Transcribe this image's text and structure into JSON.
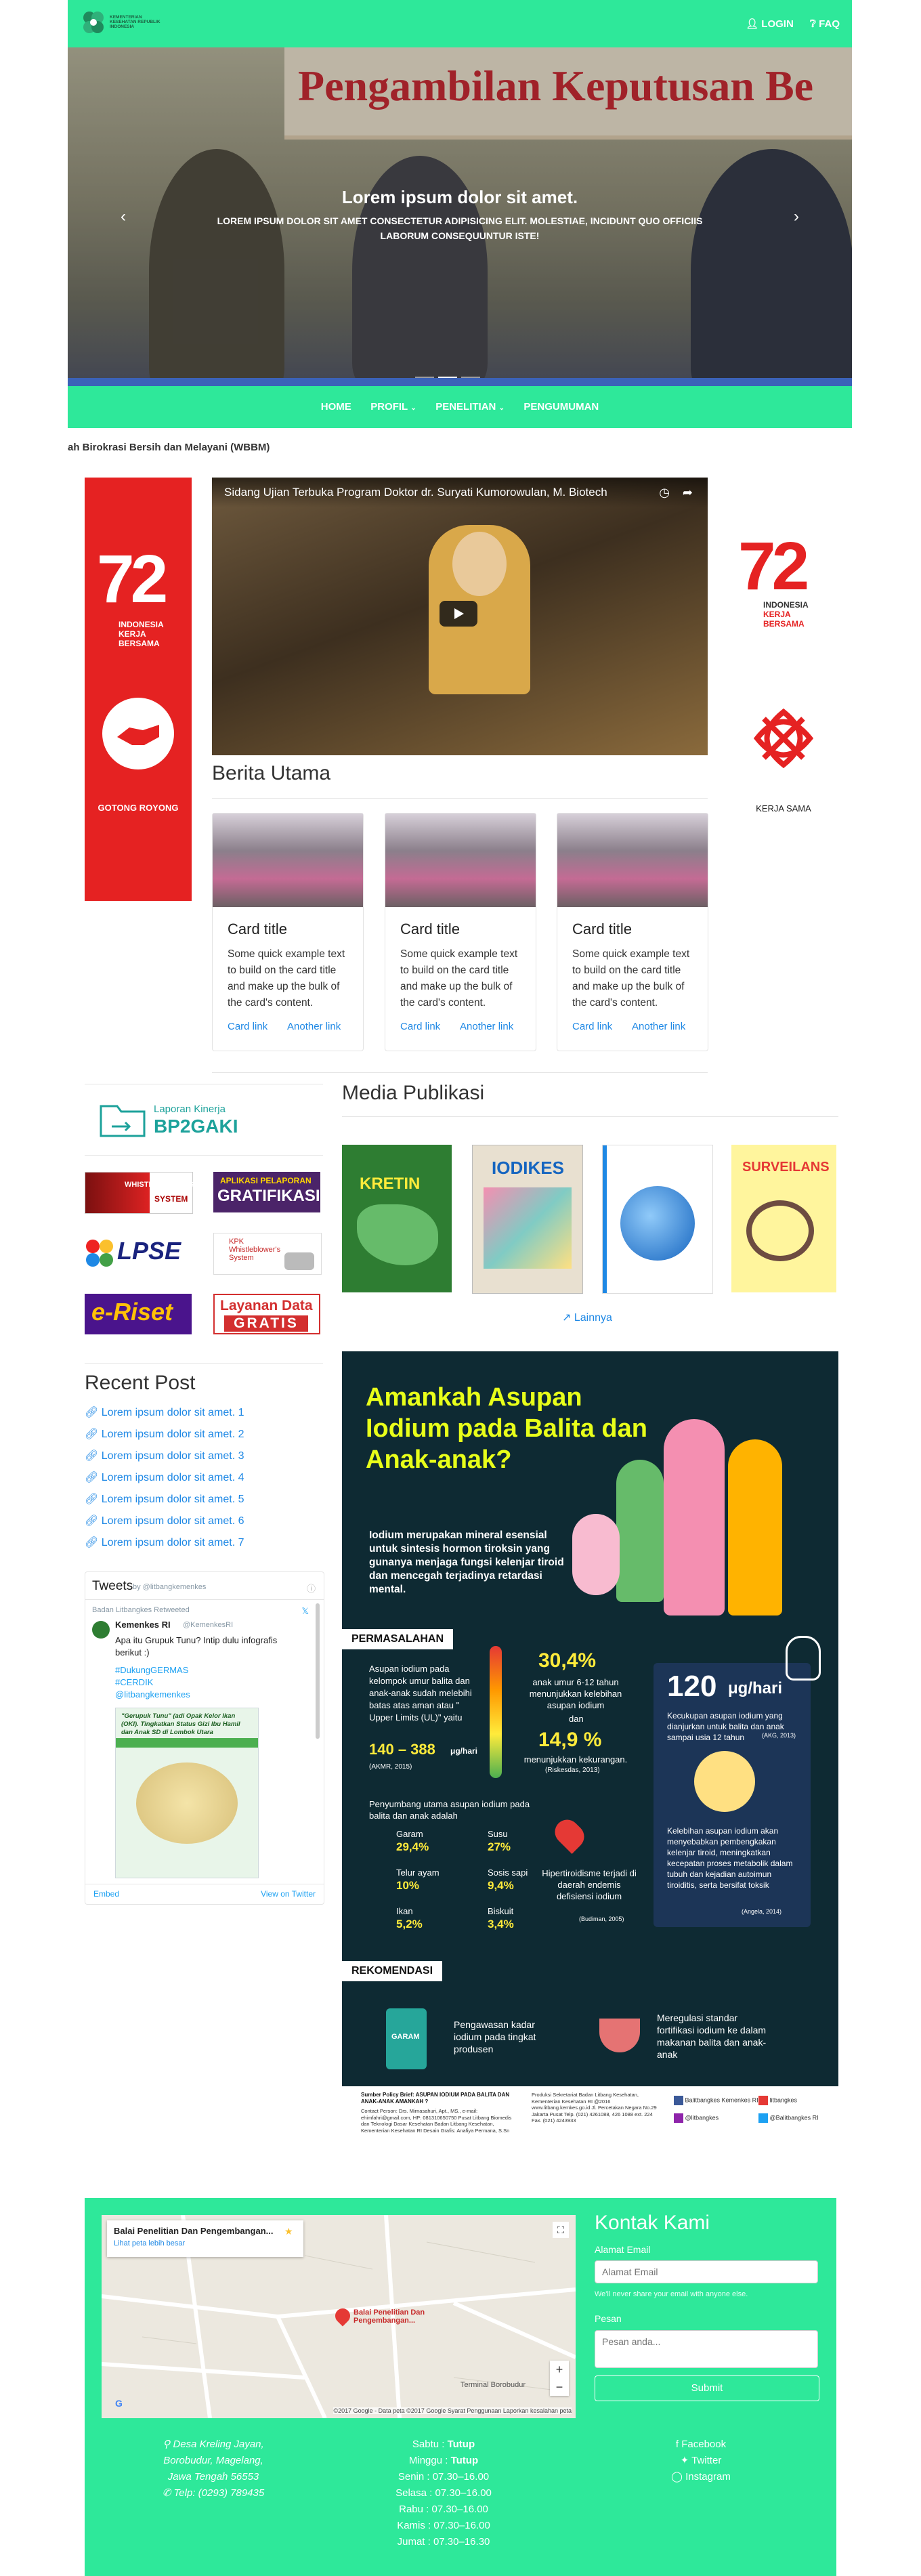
{
  "header": {
    "logo_text": "KEMENTERIAN KESEHATAN REPUBLIK INDONESIA",
    "login": "LOGIN",
    "faq": "FAQ"
  },
  "hero": {
    "banner": "Pengambilan Keputusan Be",
    "heading": "Lorem ipsum dolor sit amet.",
    "text": "LOREM IPSUM DOLOR SIT AMET CONSECTETUR ADIPISICING ELIT. MOLESTIAE, INCIDUNT QUO OFFICIIS LABORUM CONSEQUUNTUR ISTE!",
    "prev": "‹",
    "next": "›"
  },
  "nav": {
    "items": [
      "HOME",
      "PROFIL",
      "PENELITIAN",
      "PENGUMUMAN"
    ]
  },
  "marquee": "ah Birokrasi Bersih dan Melayani (WBBM)",
  "side_left": {
    "number": "72",
    "line1": "INDONESIA",
    "line2": "KERJA",
    "line3": "BERSAMA",
    "caption": "GOTONG ROYONG"
  },
  "side_right": {
    "number": "72",
    "line1": "INDONESIA",
    "line2": "KERJA",
    "line3": "BERSAMA",
    "caption": "KERJA SAMA"
  },
  "video": {
    "title": "Sidang Ujian Terbuka Program Doktor dr. Suryati Kumorowulan, M. Biotech"
  },
  "berita": {
    "heading": "Berita Utama",
    "cards": [
      {
        "title": "Card title",
        "text": "Some quick example text to build on the card title and make up the bulk of the card's content.",
        "link1": "Card link",
        "link2": "Another link"
      },
      {
        "title": "Card title",
        "text": "Some quick example text to build on the card title and make up the bulk of the card's content.",
        "link1": "Card link",
        "link2": "Another link"
      },
      {
        "title": "Card title",
        "text": "Some quick example text to build on the card title and make up the bulk of the card's content.",
        "link1": "Card link",
        "link2": "Another link"
      }
    ]
  },
  "widgets": {
    "laporan1": "Laporan Kinerja",
    "laporan2": "BP2GAKI",
    "wb1": "WHISTLEBLOWING",
    "wb2": "SYSTEM",
    "grat1": "APLIKASI PELAPORAN",
    "grat2": "GRATIFIKASI",
    "lpse": "LPSE",
    "kpk": "KPK Whistleblower's System",
    "eriset": "e-Riset",
    "layanan1": "Layanan Data",
    "layanan2": "GRATIS"
  },
  "media": {
    "heading": "Media Publikasi",
    "books": [
      "KRETIN",
      "IODIKES",
      "",
      "SURVEILANS"
    ],
    "more": "Lainnya"
  },
  "recent": {
    "heading": "Recent Post",
    "items": [
      "Lorem ipsum dolor sit amet. 1",
      "Lorem ipsum dolor sit amet. 2",
      "Lorem ipsum dolor sit amet. 3",
      "Lorem ipsum dolor sit amet. 4",
      "Lorem ipsum dolor sit amet. 5",
      "Lorem ipsum dolor sit amet. 6",
      "Lorem ipsum dolor sit amet. 7"
    ]
  },
  "tweets": {
    "title": "Tweets",
    "by": "by @litbangkemenkes",
    "retweeted": "Badan Litbangkes Retweeted",
    "user": "Kemenkes RI",
    "handle": "@KemenkesRI",
    "text": "Apa itu Grupuk Tunu? Intip dulu infografis berikut :)",
    "tags": [
      "#DukungGERMAS",
      "#CERDIK",
      "@litbangkemenkes"
    ],
    "embed": "Embed",
    "view": "View on Twitter",
    "img_title": "\"Gerupuk Tunu\" (adi Opak Kelor Ikan (OKI). Tingkatkan Status Gizi Ibu Hamil dan Anak SD di Lombok Utara"
  },
  "info": {
    "title": "Amankah Asupan Iodium pada Balita dan Anak-anak?",
    "intro": "Iodium merupakan mineral esensial untuk sintesis hormon tiroksin yang gunanya menjaga fungsi kelenjar tiroid dan mencegah terjadinya retardasi mental.",
    "s1": "PERMASALAHAN",
    "aman": "Asupan iodium pada kelompok umur balita dan anak-anak sudah melebihi batas atas aman atau \" Upper Limits (UL)\" yaitu",
    "range": "140 – 388",
    "unit": "μg/hari",
    "src1": "(AKMR, 2015)",
    "p1": "30,4%",
    "p1t": "anak umur 6-12 tahun menunjukkan kelebihan asupan iodium",
    "dan": "dan",
    "p2": "14,9 %",
    "p2t": "menunjukkan kekurangan.",
    "src2": "(Riskesdas, 2013)",
    "need": "120",
    "needu": "μg/hari",
    "needt": "Kecukupan asupan iodium yang dianjurkan untuk balita dan anak sampai usia 12 tahun",
    "src3": "(AKG, 2013)",
    "contrib": "Penyumbang utama asupan iodium pada balita dan anak adalah",
    "foods": [
      [
        "Garam",
        "29,4%"
      ],
      [
        "Susu",
        "27%"
      ],
      [
        "Telur ayam",
        "10%"
      ],
      [
        "Sosis sapi",
        "9,4%"
      ],
      [
        "Ikan",
        "5,2%"
      ],
      [
        "Biskuit",
        "3,4%"
      ]
    ],
    "hyper": "Hipertiroidisme terjadi di daerah endemis defisiensi iodium",
    "src4": "(Budiman, 2005)",
    "excess": "Kelebihan asupan iodium akan menyebabkan pembengkakan kelenjar tiroid, meningkatkan kecepatan proses metabolik dalam tubuh dan kejadian autoimun tiroiditis, serta bersifat toksik",
    "src5": "(Angela, 2014)",
    "s2": "REKOMENDASI",
    "r1": "Pengawasan kadar iodium pada tingkat produsen",
    "r2": "Meregulasi standar fortifikasi iodium ke dalam makanan balita dan anak-anak",
    "garam": "GARAM",
    "foot1": "Sumber Policy Brief: ASUPAN IODIUM PADA BALITA DAN ANAK-ANAK AMANKAH ?",
    "foot2": "Contact Person: Drs. Mirnasahuri, Apt., MS., e-mail: ehimfahri@gmail.com, HP: 081310650750 Pusat Litbang Biomedis dan Teknologi Dasar Kesehatan Badan Litbang Kesehatan, Kementerian Kesehatan RI Desain Grafis: Anafiya Permana, S.Sn",
    "foot3": "Produksi Sekretariat Badan Litbang Kesehatan, Kementerian Kesehatan RI @2016 www.litbang.kemkes.go.id Jl. Percetakan Negara No.29 Jakarta Pusat Telp. (021) 4261088, 426 1088 ext. 224 Fax. (021) 4243933",
    "soc": [
      "Balitbangkes Kemenkes RI",
      "litbangkes",
      "@litbangkes",
      "@Balitbangkes RI"
    ]
  },
  "footer": {
    "map_title": "Balai Penelitian Dan Pengembangan...",
    "map_link": "Lihat peta lebih besar",
    "map_pin": "Balai Penelitian Dan Pengembangan...",
    "map_pin2": "Terminal Borobudur",
    "map_copy": "©2017 Google - Data peta ©2017 Google   Syarat Penggunaan   Laporkan kesalahan peta",
    "kontak": "Kontak Kami",
    "email_label": "Alamat Email",
    "email_ph": "Alamat Email",
    "email_help": "We'll never share your email with anyone else.",
    "pesan_label": "Pesan",
    "pesan_ph": "Pesan anda...",
    "submit": "Submit",
    "addr": [
      "Desa Kreling Jayan,",
      "Borobudur, Magelang,",
      "Jawa Tengah 56553",
      "Telp: (0293) 789435"
    ],
    "hours": [
      [
        "Sabtu : ",
        "Tutup"
      ],
      [
        "Minggu : ",
        "Tutup"
      ],
      [
        "Senin : 07.30–16.00",
        ""
      ],
      [
        "Selasa : 07.30–16.00",
        ""
      ],
      [
        "Rabu : 07.30–16.00",
        ""
      ],
      [
        "Kamis : 07.30–16.00",
        ""
      ],
      [
        "Jumat : 07.30–16.30",
        ""
      ]
    ],
    "social": [
      "Facebook",
      "Twitter",
      "Instagram"
    ]
  }
}
